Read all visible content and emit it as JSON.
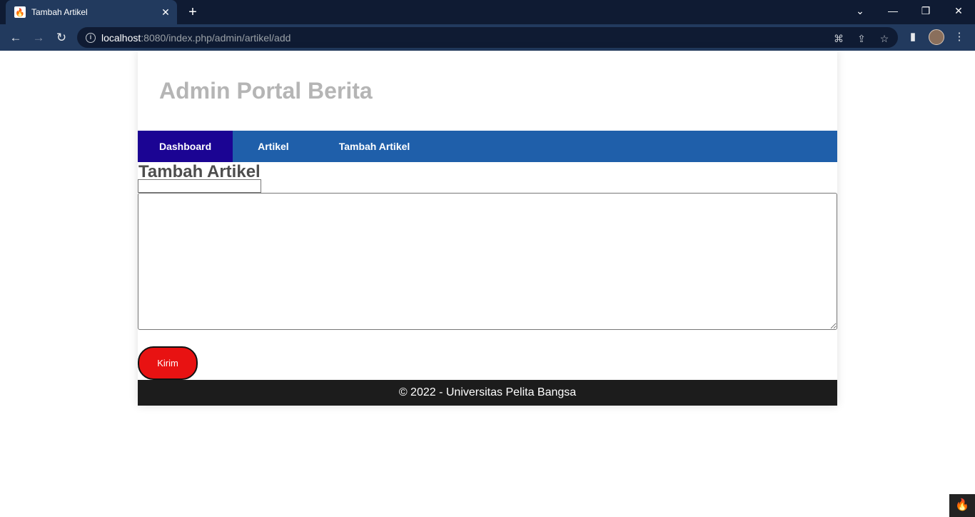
{
  "browser": {
    "tab_title": "Tambah Artikel",
    "favicon_glyph": "🔥",
    "close_glyph": "✕",
    "newtab_glyph": "+",
    "url_host": "localhost",
    "url_path": ":8080/index.php/admin/artikel/add",
    "back_glyph": "←",
    "forward_glyph": "→",
    "reload_glyph": "↻",
    "info_glyph": "i",
    "translate_glyph": "⌘",
    "share_glyph": "⇪",
    "star_glyph": "☆",
    "sidepanel_glyph": "▮",
    "menu_glyph": "⋮",
    "minimize_glyph": "—",
    "restore_glyph": "❐",
    "winclose_glyph": "✕",
    "tabsearch_glyph": "⌄"
  },
  "site": {
    "header_title": "Admin Portal Berita",
    "nav": [
      {
        "label": "Dashboard",
        "active": true
      },
      {
        "label": "Artikel",
        "active": false
      },
      {
        "label": "Tambah Artikel",
        "active": false
      }
    ],
    "page_heading": "Tambah Artikel",
    "title_input_value": "",
    "body_textarea_value": "",
    "submit_label": "Kirim",
    "footer_text": "© 2022 - Universitas Pelita Bangsa"
  },
  "debug_toolbar": {
    "glyph": "🔥"
  },
  "colors": {
    "nav_bg": "#1f5faa",
    "nav_active_bg": "#1b0493",
    "submit_bg": "#e81212",
    "footer_bg": "#1c1c1c",
    "header_text": "#b5b5b5"
  }
}
